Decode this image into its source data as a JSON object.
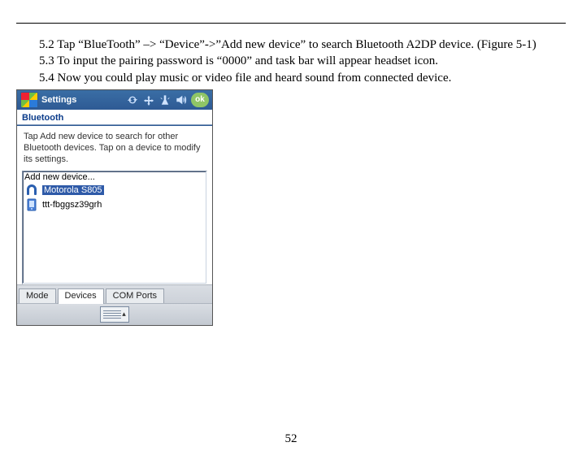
{
  "body": {
    "p1": "5.2 Tap “BlueTooth” –> “Device”->”Add new device” to search Bluetooth A2DP device. (Figure 5-1)",
    "p2": "5.3 To input the pairing password is “0000” and task bar will appear headset icon.",
    "p3": "5.4 Now you could play music or video file and heard sound from connected device."
  },
  "titlebar": {
    "title": "Settings",
    "ok": "ok"
  },
  "section": {
    "label": "Bluetooth"
  },
  "instructions": {
    "text": "Tap Add new device to search for other Bluetooth devices. Tap on a device to modify its settings."
  },
  "devices": {
    "add": "Add new device...",
    "item1": "Motorola S805",
    "item2": "ttt-fbggsz39grh"
  },
  "tabs": {
    "mode": "Mode",
    "devices": "Devices",
    "comports": "COM Ports"
  },
  "pagenum": "52"
}
